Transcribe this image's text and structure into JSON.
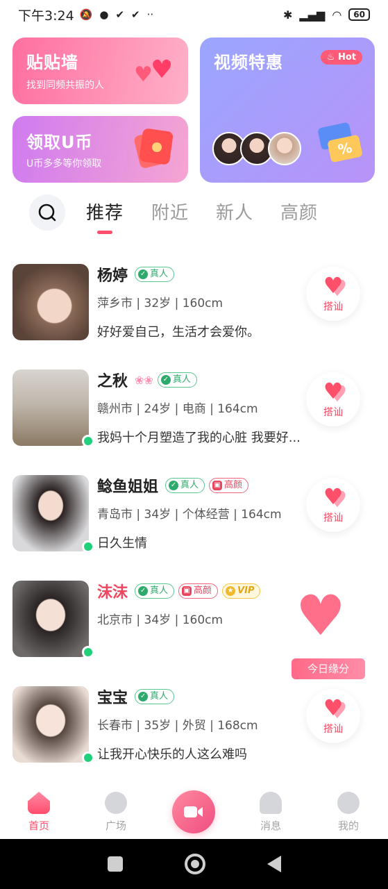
{
  "status": {
    "time": "下午3:24",
    "icons": [
      "mute-icon",
      "chat-icon",
      "check-icon",
      "check-icon",
      "more-icon"
    ],
    "right_icons": [
      "bluetooth-icon",
      "signal-icon",
      "wifi-icon"
    ],
    "battery": "60"
  },
  "cards": {
    "wall": {
      "title": "贴贴墙",
      "subtitle": "找到同频共振的人"
    },
    "coins": {
      "title": "领取U币",
      "subtitle": "U币多多等你领取"
    },
    "video": {
      "title": "视频特惠",
      "badge": "Hot"
    }
  },
  "tabs": [
    {
      "label": "推荐",
      "active": true
    },
    {
      "label": "附近"
    },
    {
      "label": "新人"
    },
    {
      "label": "高颜"
    }
  ],
  "users": [
    {
      "name": "杨婷",
      "badges": [
        "真人"
      ],
      "info": "萍乡市 | 32岁 | 160cm",
      "signature": "好好爱自己，生活才会爱你。",
      "online": false,
      "action": "搭讪"
    },
    {
      "name": "之秋",
      "flowers": "❀❀",
      "badges": [
        "真人"
      ],
      "info": "赣州市 | 24岁 | 电商 | 164cm",
      "signature": "我妈十个月塑造了我的心脏 我要好...",
      "online": true,
      "action": "搭讪"
    },
    {
      "name": "鲶鱼姐姐",
      "badges": [
        "真人",
        "高颜"
      ],
      "info": "青岛市 | 34岁 | 个体经营 | 164cm",
      "signature": "日久生情",
      "online": true,
      "action": "搭讪"
    },
    {
      "name": "沫沫",
      "badges": [
        "真人",
        "高颜",
        "VIP"
      ],
      "info": "北京市 | 34岁 | 160cm",
      "signature": "",
      "online": true,
      "action": "今日缘分"
    },
    {
      "name": "宝宝",
      "badges": [
        "真人"
      ],
      "info": "长春市 | 35岁 | 外贸 | 168cm",
      "signature": "让我开心快乐的人这么难吗",
      "online": true,
      "action": "搭讪"
    }
  ],
  "nav": {
    "home": "首页",
    "square": "广场",
    "messages": "消息",
    "mine": "我的"
  },
  "colors": {
    "accent": "#ff4d6d",
    "online": "#1ed17a",
    "verified": "#2eaa6c"
  }
}
